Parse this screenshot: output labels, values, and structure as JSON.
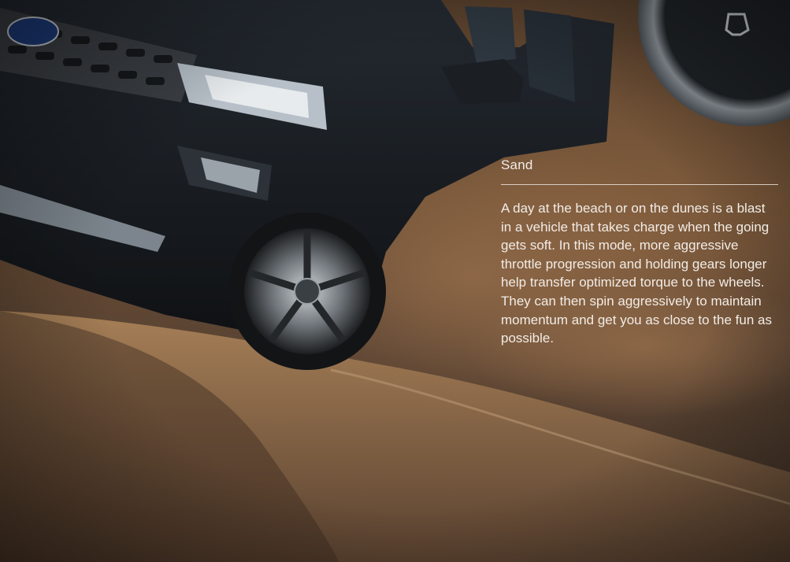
{
  "mode": {
    "title": "Sand",
    "description": "A day at the beach or on the dunes is a blast in a vehicle that takes charge when the going gets soft. In this mode, more aggressive throttle progression and holding gears longer help transfer optimized torque to the wheels. They can then spin aggressively to maintain momentum and get you as close to the fun as possible."
  },
  "background": {
    "vehicle_badge": "Ford"
  },
  "icons": {
    "dial_icon": "terrain-mode-icon"
  },
  "colors": {
    "sand": "#6a4c33",
    "vehicle_body": "#15181c",
    "text": "#f2ece6"
  }
}
